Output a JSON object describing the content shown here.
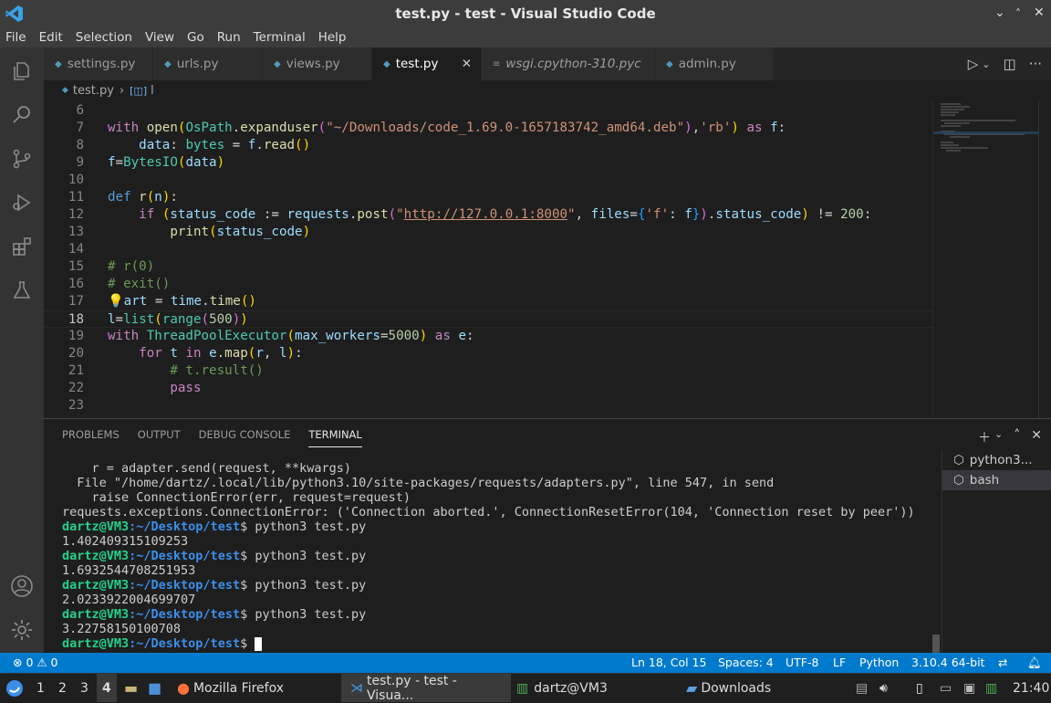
{
  "window": {
    "title": "test.py - test - Visual Studio Code"
  },
  "menu": [
    "File",
    "Edit",
    "Selection",
    "View",
    "Go",
    "Run",
    "Terminal",
    "Help"
  ],
  "tabs": [
    {
      "label": "settings.py"
    },
    {
      "label": "urls.py"
    },
    {
      "label": "views.py"
    },
    {
      "label": "test.py"
    },
    {
      "label": "wsgi.cpython-310.pyc"
    },
    {
      "label": "admin.py"
    }
  ],
  "breadcrumb": {
    "file": "test.py",
    "symbol": "l"
  },
  "editor": {
    "current_line": 18,
    "lines": [
      {
        "n": "6"
      },
      {
        "n": "7"
      },
      {
        "n": "8"
      },
      {
        "n": "9"
      },
      {
        "n": "10"
      },
      {
        "n": "11"
      },
      {
        "n": "12"
      },
      {
        "n": "13"
      },
      {
        "n": "14"
      },
      {
        "n": "15"
      },
      {
        "n": "16"
      },
      {
        "n": "17"
      },
      {
        "n": "18"
      },
      {
        "n": "19"
      },
      {
        "n": "20"
      },
      {
        "n": "21"
      },
      {
        "n": "22"
      },
      {
        "n": "23"
      }
    ]
  },
  "panel": {
    "tabs": [
      "PROBLEMS",
      "OUTPUT",
      "DEBUG CONSOLE",
      "TERMINAL"
    ],
    "active_tab": "TERMINAL",
    "terminals": [
      "python3...",
      "bash"
    ],
    "output": [
      "    r = adapter.send(request, **kwargs)",
      "  File \"/home/dartz/.local/lib/python3.10/site-packages/requests/adapters.py\", line 547, in send",
      "    raise ConnectionError(err, request=request)",
      "requests.exceptions.ConnectionError: ('Connection aborted.', ConnectionResetError(104, 'Connection reset by peer'))"
    ],
    "prompt_user": "dartz@VM3",
    "prompt_path": ":~/Desktop/test",
    "runs": [
      {
        "cmd": "$ python3 test.py",
        "out": "1.402409315109253"
      },
      {
        "cmd": "$ python3 test.py",
        "out": "1.6932544708251953"
      },
      {
        "cmd": "$ python3 test.py",
        "out": "2.0233922004699707"
      },
      {
        "cmd": "$ python3 test.py",
        "out": "3.22758150100708"
      }
    ],
    "last_prompt": "$ "
  },
  "status": {
    "problems": "⊗ 0 ⚠ 0",
    "position": "Ln 18, Col 15",
    "spaces": "Spaces: 4",
    "encoding": "UTF-8",
    "eol": "LF",
    "language": "Python",
    "interpreter": "3.10.4 64-bit"
  },
  "taskbar": {
    "workspaces": [
      "1",
      "2",
      "3",
      "4"
    ],
    "apps": [
      "Mozilla Firefox",
      "test.py - test - Visua...",
      "dartz@VM3",
      "Downloads"
    ],
    "clock": "21:40"
  },
  "colors": {
    "accent": "#007acc",
    "titlebar": "#3c3c3c",
    "editor_bg": "#1e1e1e"
  }
}
